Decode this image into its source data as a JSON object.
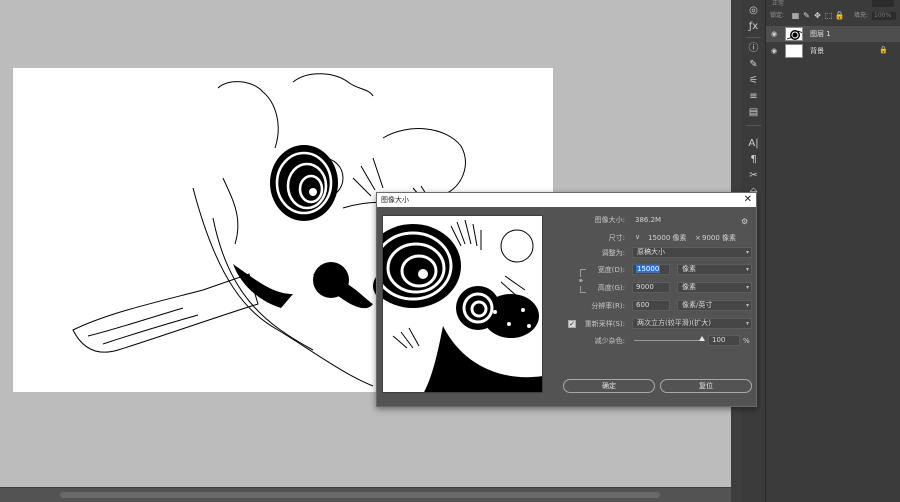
{
  "layers_panel": {
    "blend_mode": "正常",
    "lock_label": "锁定:",
    "fill_label": "填充:",
    "fill_value": "100%",
    "layers": [
      {
        "name": "图层 1",
        "visible": true,
        "selected": true,
        "locked": false
      },
      {
        "name": "背景",
        "visible": true,
        "selected": false,
        "locked": true
      }
    ]
  },
  "tools": [
    "dial-icon",
    "fx-icon",
    "info-icon",
    "brush-icon",
    "sliders-icon",
    "adjust-icon",
    "clone-icon",
    "text-icon",
    "paragraph-icon",
    "tools-icon",
    "bucket-icon"
  ],
  "dialog": {
    "title": "图像大小",
    "close_glyph": "✕",
    "image_size_label": "图像大小:",
    "image_size_value": "386.2M",
    "dimensions_label": "尺寸:",
    "dimensions_w": "15000 像素",
    "dimensions_x": "×",
    "dimensions_h": "9000 像素",
    "fit_to_label": "调整为:",
    "fit_to_value": "原稿大小",
    "width_label": "宽度(D):",
    "width_value": "15000",
    "width_unit": "像素",
    "height_label": "高度(G):",
    "height_value": "9000",
    "height_unit": "像素",
    "resolution_label": "分辨率(R):",
    "resolution_value": "600",
    "resolution_unit": "像素/英寸",
    "resample_label": "重新采样(S):",
    "resample_checked": true,
    "resample_method": "两次立方(较平滑)(扩大)",
    "noise_label": "减少杂色:",
    "noise_value": "100",
    "noise_unit": "%",
    "noise_level": 1.0,
    "ok_label": "确定",
    "cancel_label": "复位"
  },
  "colors": {
    "workspace": "#bcbcbc",
    "panel": "#3b3b3b",
    "dialog": "#535353",
    "highlight": "#2f6fd6"
  }
}
